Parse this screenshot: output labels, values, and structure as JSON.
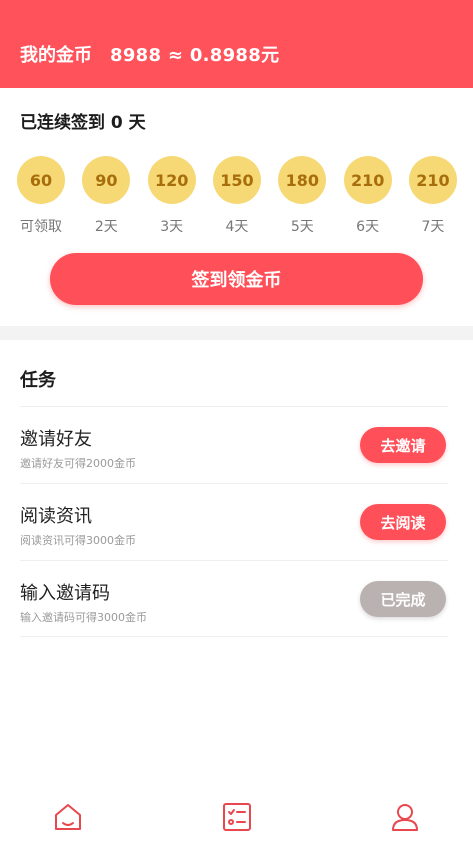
{
  "header": {
    "title": "我的金币",
    "balance": "8988 ≈ 0.8988元",
    "bg_color": "#ff525a"
  },
  "signin": {
    "streak_text": "已连续签到 0 天",
    "days": [
      {
        "coins": "60",
        "label": "可领取"
      },
      {
        "coins": "90",
        "label": "2天"
      },
      {
        "coins": "120",
        "label": "3天"
      },
      {
        "coins": "150",
        "label": "4天"
      },
      {
        "coins": "180",
        "label": "5天"
      },
      {
        "coins": "210",
        "label": "6天"
      },
      {
        "coins": "210",
        "label": "7天"
      }
    ],
    "button_label": "签到领金币",
    "coin_color": "#f6d975",
    "button_color": "#ff4f58"
  },
  "tasks": {
    "title": "任务",
    "items": [
      {
        "name": "邀请好友",
        "desc": "邀请好友可得2000金币",
        "action": "去邀请",
        "done": false
      },
      {
        "name": "阅读资讯",
        "desc": "阅读资讯可得3000金币",
        "action": "去阅读",
        "done": false
      },
      {
        "name": "输入邀请码",
        "desc": "输入邀请码可得3000金币",
        "action": "已完成",
        "done": true
      }
    ],
    "done_color": "#b9b2b0"
  },
  "bottom_nav": {
    "items": [
      {
        "icon": "home-icon"
      },
      {
        "icon": "task-list-icon"
      },
      {
        "icon": "user-icon"
      }
    ],
    "icon_color": "#e8474f"
  }
}
